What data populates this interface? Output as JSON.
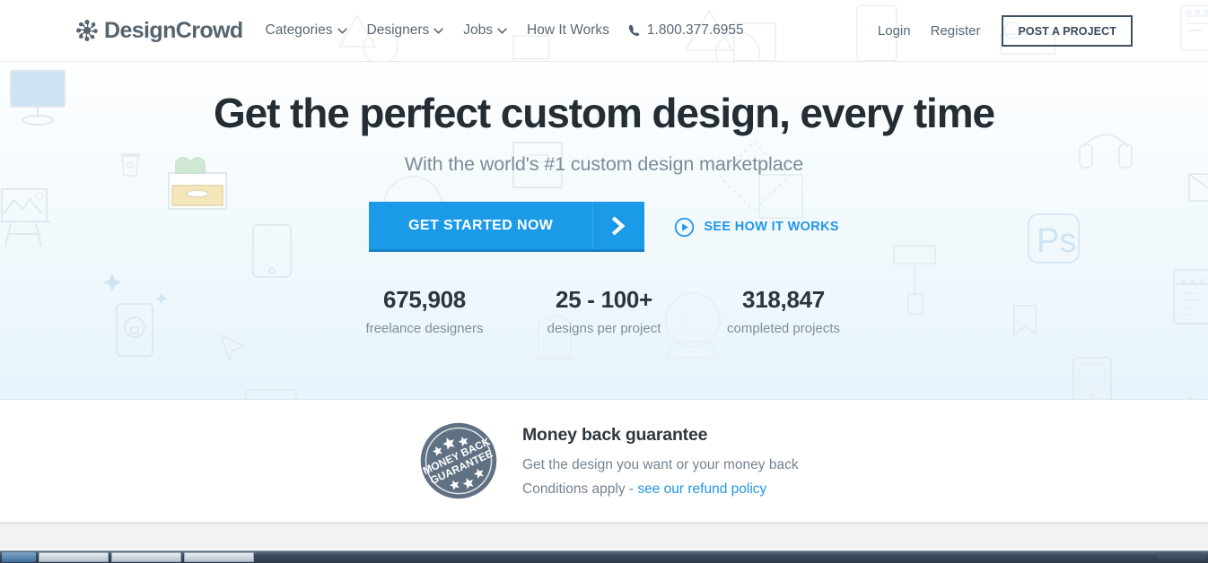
{
  "header": {
    "logo": {
      "text": "DesignCrowd",
      "icon": "starburst-logo-icon"
    },
    "nav": [
      {
        "label": "Categories",
        "has_caret": true
      },
      {
        "label": "Designers",
        "has_caret": true
      },
      {
        "label": "Jobs",
        "has_caret": true
      },
      {
        "label": "How It Works",
        "has_caret": false
      }
    ],
    "phone": {
      "number": "1.800.377.6955",
      "icon": "phone-icon"
    },
    "login_label": "Login",
    "register_label": "Register",
    "post_project_label": "POST A PROJECT"
  },
  "hero": {
    "title": "Get the perfect custom design, every time",
    "subtitle": "With the world's #1 custom design marketplace",
    "cta_label": "GET STARTED NOW",
    "cta_arrow_icon": "chevron-right-icon",
    "how_it_works_label": "SEE HOW IT WORKS",
    "how_it_works_icon": "play-circle-icon",
    "stats": [
      {
        "number": "675,908",
        "label": "freelance designers"
      },
      {
        "number": "25 - 100+",
        "label": "designs per project"
      },
      {
        "number": "318,847",
        "label": "completed projects"
      }
    ]
  },
  "guarantee": {
    "badge_icon": "money-back-guarantee-seal-icon",
    "badge_text_top": "MONEY BACK",
    "badge_text_bottom": "GUARANTEE",
    "title": "Money back guarantee",
    "line1": "Get the design you want or your money back",
    "line2_prefix": "Conditions apply - ",
    "line2_link": "see our refund policy"
  },
  "colors": {
    "accent_blue": "#1b9ae8",
    "accent_blue_dark": "#1584c6",
    "heading": "#242d33",
    "muted_text": "#7b8c99",
    "logo_gray": "#56646f",
    "badge_slate": "#5f7183",
    "hero_bg_bottom": "#e7f4fb"
  }
}
